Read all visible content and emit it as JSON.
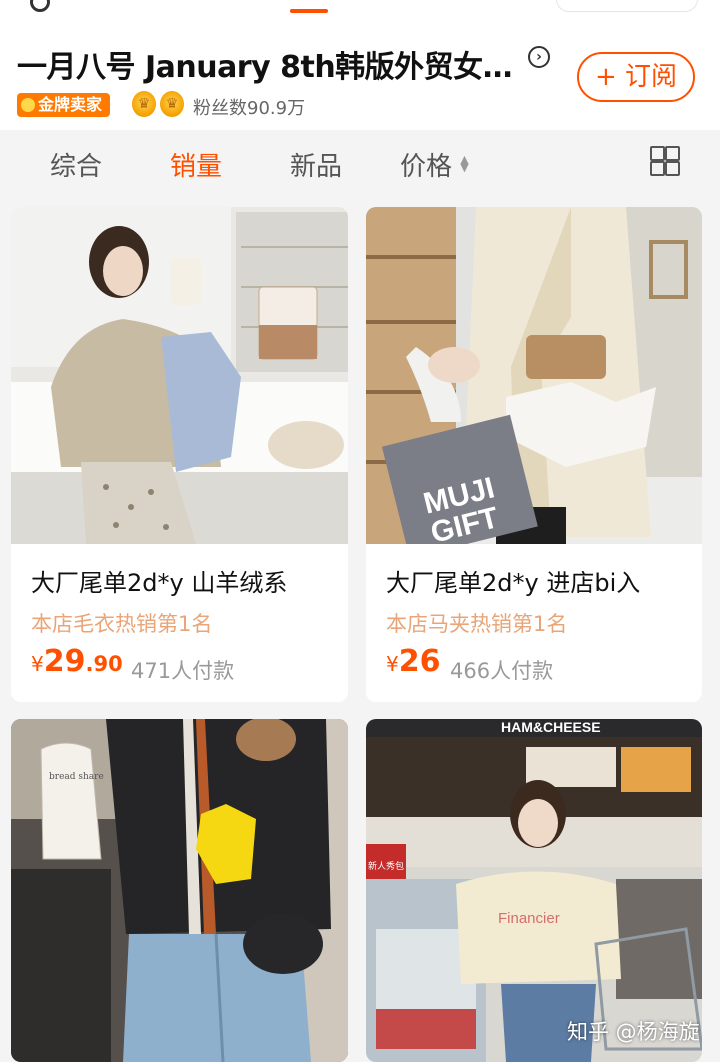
{
  "shop": {
    "name": "一月八号 January 8th韩版外贸女…",
    "subscribe_label": "+ 订阅",
    "badge": "金牌卖家",
    "fans": "粉丝数90.9万"
  },
  "sort_tabs": [
    {
      "label": "综合",
      "active": false
    },
    {
      "label": "销量",
      "active": true
    },
    {
      "label": "新品",
      "active": false
    },
    {
      "label": "价格",
      "active": false
    }
  ],
  "products": [
    {
      "title": "大厂尾单2d*y 山羊绒系",
      "tag": "本店毛衣热销第1名",
      "price_symbol": "¥",
      "price_int": "29",
      "price_dec": ".90",
      "sales": "471人付款"
    },
    {
      "title": "大厂尾单2d*y  进店bi入",
      "tag": "本店马夹热销第1名",
      "price_symbol": "¥",
      "price_int": "26",
      "price_dec": "",
      "sales": "466人付款"
    },
    {
      "photo_text": "bread share"
    },
    {
      "photo_text_1": "HAM&CHEESE",
      "photo_text_2": "Financier",
      "photo_text_3": "新人秀包"
    }
  ],
  "watermark": "知乎 @杨海旋",
  "colors": {
    "accent": "#ff5000",
    "tag": "#e9a578",
    "background": "#f4f4f4"
  }
}
